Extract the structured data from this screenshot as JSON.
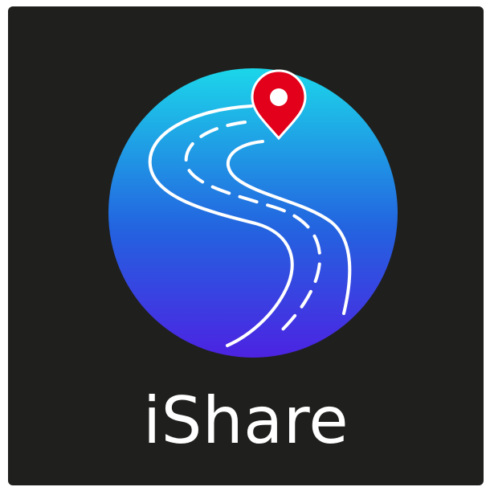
{
  "app_name": "iShare",
  "colors": {
    "tile_background": "#1f1f1d",
    "circle_gradient_top": "#1cd6ea",
    "circle_gradient_middle": "#2364e0",
    "circle_gradient_bottom": "#4c23e2",
    "road_lines": "#ffffff",
    "pin_fill": "#e3001b",
    "pin_center": "#ffffff",
    "app_name_text": "#ffffff"
  },
  "icons": {
    "logo": "winding-road-icon",
    "marker": "map-pin-icon"
  }
}
